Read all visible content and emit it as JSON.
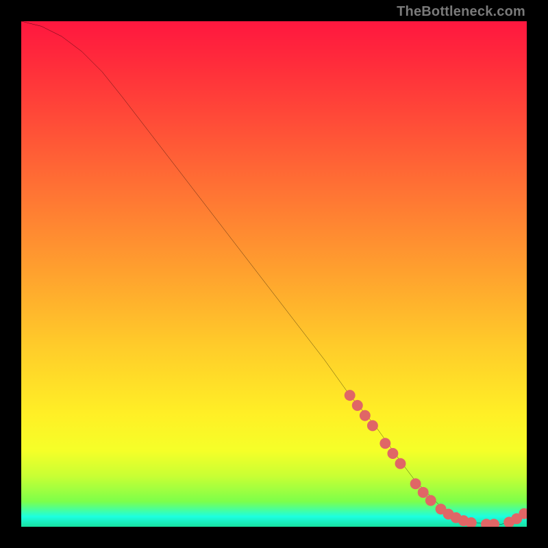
{
  "watermark": "TheBottleneck.com",
  "chart_data": {
    "type": "line",
    "title": "",
    "xlabel": "",
    "ylabel": "",
    "xlim": [
      0,
      100
    ],
    "ylim": [
      0,
      100
    ],
    "grid": false,
    "legend": false,
    "series": [
      {
        "name": "curve",
        "color": "#000000",
        "x": [
          0,
          4,
          8,
          12,
          16,
          20,
          30,
          40,
          50,
          60,
          65,
          70,
          75,
          78,
          80,
          83,
          86,
          89,
          92,
          95,
          97,
          100
        ],
        "y": [
          100,
          99,
          97,
          94,
          90,
          85,
          72,
          59,
          46,
          33,
          26,
          20,
          13,
          9,
          7,
          4,
          2,
          1,
          0.5,
          0.5,
          1,
          3
        ]
      }
    ],
    "markers": [
      {
        "name": "dots",
        "color": "#e06666",
        "radius": 8,
        "points": [
          {
            "x": 65.0,
            "y": 26.0
          },
          {
            "x": 66.5,
            "y": 24.0
          },
          {
            "x": 68.0,
            "y": 22.0
          },
          {
            "x": 69.5,
            "y": 20.0
          },
          {
            "x": 72.0,
            "y": 16.5
          },
          {
            "x": 73.5,
            "y": 14.5
          },
          {
            "x": 75.0,
            "y": 12.5
          },
          {
            "x": 78.0,
            "y": 8.5
          },
          {
            "x": 79.5,
            "y": 6.8
          },
          {
            "x": 81.0,
            "y": 5.2
          },
          {
            "x": 83.0,
            "y": 3.5
          },
          {
            "x": 84.5,
            "y": 2.5
          },
          {
            "x": 86.0,
            "y": 1.8
          },
          {
            "x": 87.5,
            "y": 1.2
          },
          {
            "x": 89.0,
            "y": 0.8
          },
          {
            "x": 92.0,
            "y": 0.5
          },
          {
            "x": 93.5,
            "y": 0.5
          },
          {
            "x": 96.5,
            "y": 0.9
          },
          {
            "x": 98.0,
            "y": 1.6
          },
          {
            "x": 99.5,
            "y": 2.6
          }
        ]
      }
    ]
  }
}
